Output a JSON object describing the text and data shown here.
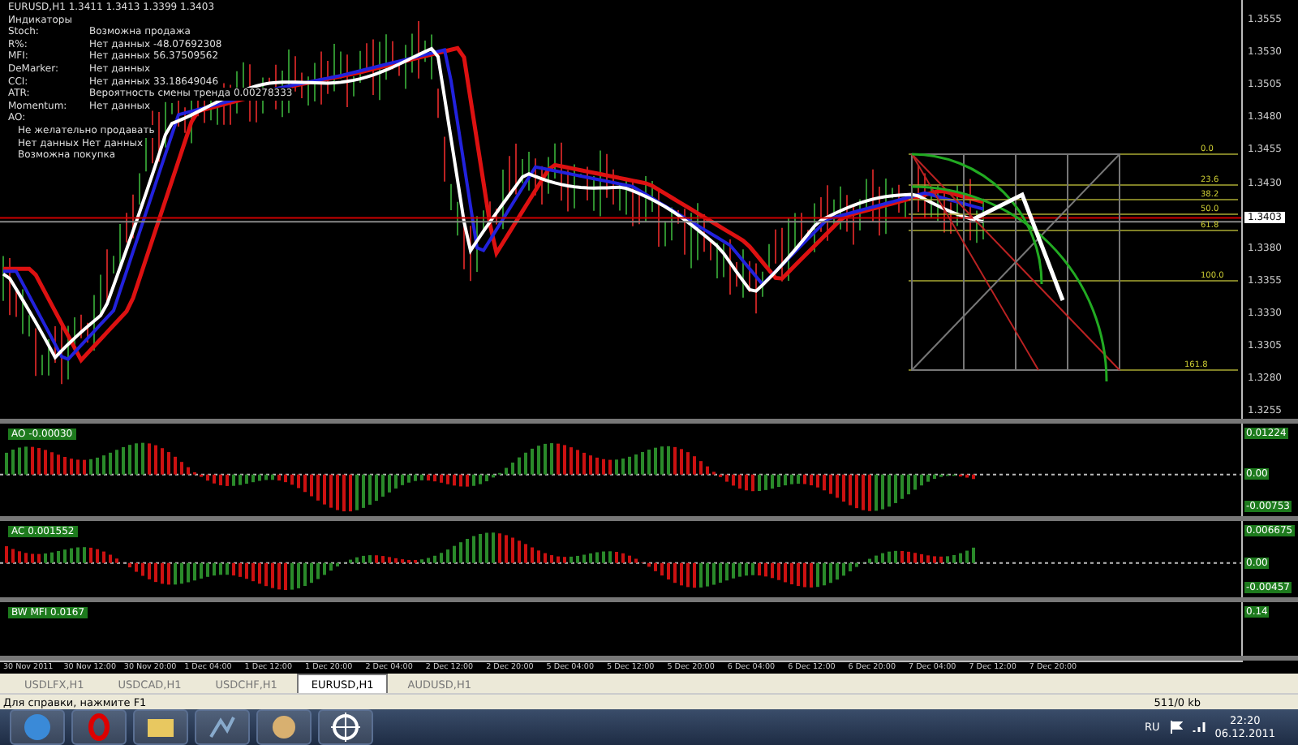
{
  "chart_window": {
    "title": "EURUSD,H1  1.3411 1.3413 1.3399 1.3403",
    "indicator_panel": {
      "heading": "Индикаторы",
      "rows": [
        {
          "label": "Stoch:",
          "value": "Возможна продажа"
        },
        {
          "label": "R%:",
          "value": "Нет данных -48.07692308"
        },
        {
          "label": "MFI:",
          "value": "Нет данных 56.37509562"
        },
        {
          "label": "DeMarker:",
          "value": "Нет данных"
        },
        {
          "label": "CCI:",
          "value": "Нет данных 33.18649046"
        },
        {
          "label": "ATR:",
          "value": "Вероятность смены тренда 0.00278333"
        },
        {
          "label": "Momentum:",
          "value": "Нет данных"
        },
        {
          "label": "AO:",
          "value": ""
        }
      ],
      "notes": [
        "Не желательно продавать",
        "Нет данных Нет данных",
        "Возможна покупка"
      ]
    },
    "price_ticks": [
      "1.3555",
      "1.3530",
      "1.3505",
      "1.3480",
      "1.3455",
      "1.3430",
      "1.3380",
      "1.3355",
      "1.3330",
      "1.3305",
      "1.3280",
      "1.3255"
    ],
    "current_price": "1.3403",
    "fib_levels": [
      "0.0",
      "23.6",
      "38.2",
      "50.0",
      "61.8",
      "100.0",
      "161.8"
    ],
    "panes": [
      {
        "label": "AO -0.00030",
        "ticks": [
          "0.01224",
          "0.00",
          "-0.00753"
        ]
      },
      {
        "label": "AC 0.001552",
        "ticks": [
          "0.006675",
          "0.00",
          "-0.00457"
        ]
      },
      {
        "label": "BW MFI 0.0167",
        "ticks": [
          "0.14"
        ]
      }
    ],
    "time_ticks": [
      "30 Nov 2011",
      "30 Nov 12:00",
      "30 Nov 20:00",
      "1 Dec 04:00",
      "1 Dec 12:00",
      "1 Dec 20:00",
      "2 Dec 04:00",
      "2 Dec 12:00",
      "2 Dec 20:00",
      "5 Dec 04:00",
      "5 Dec 12:00",
      "5 Dec 20:00",
      "6 Dec 04:00",
      "6 Dec 12:00",
      "6 Dec 20:00",
      "7 Dec 04:00",
      "7 Dec 12:00",
      "7 Dec 20:00"
    ]
  },
  "tabs": [
    {
      "label": "USDLFX,H1",
      "selected": false
    },
    {
      "label": "USDCAD,H1",
      "selected": false
    },
    {
      "label": "USDCHF,H1",
      "selected": false
    },
    {
      "label": "EURUSD,H1",
      "selected": true
    },
    {
      "label": "AUDUSD,H1",
      "selected": false
    }
  ],
  "status_bar": {
    "help": "Для справки, нажмите F1",
    "traffic": "511/0 kb"
  },
  "taskbar": {
    "language": "RU",
    "time": "22:20",
    "date": "06.12.2011"
  }
}
